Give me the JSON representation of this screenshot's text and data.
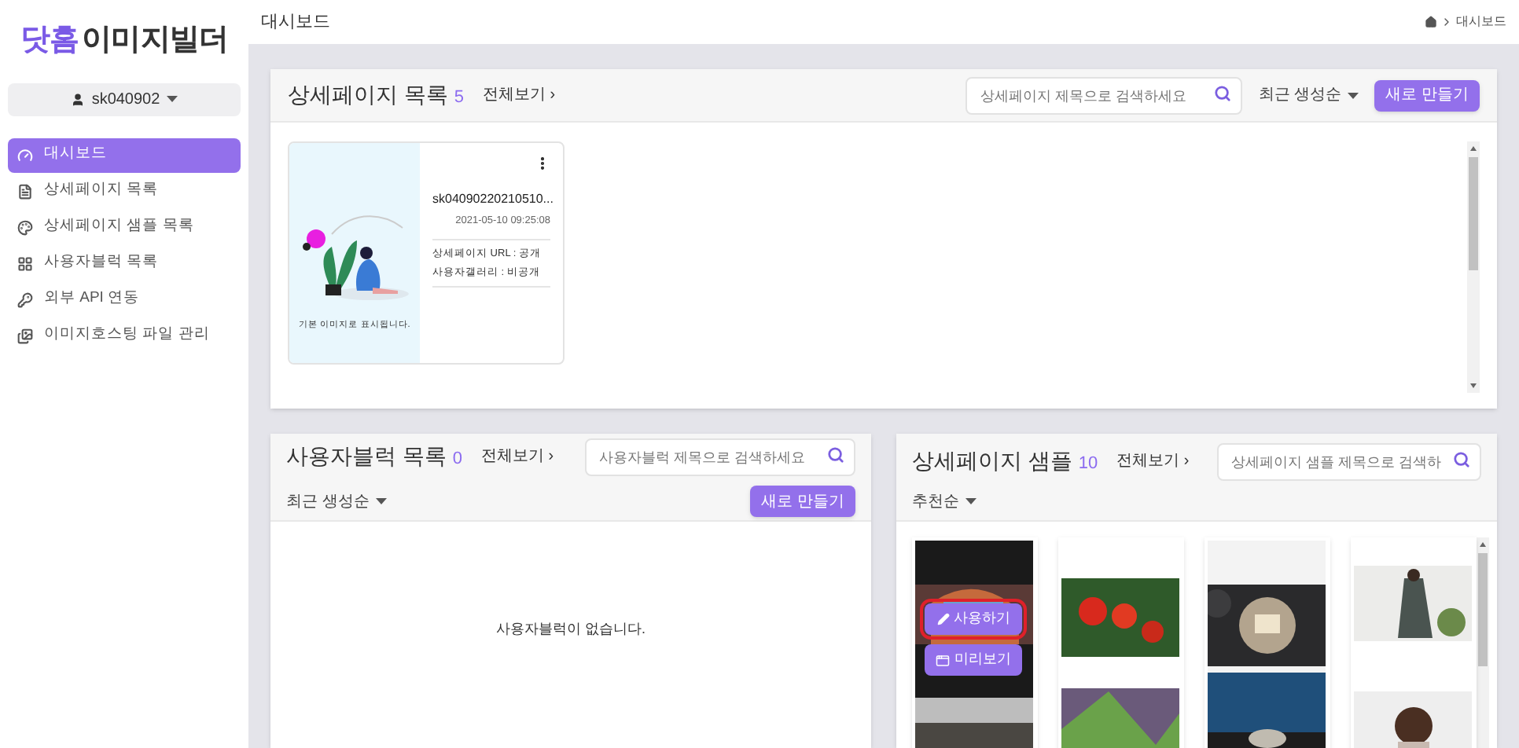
{
  "logo": {
    "part_1": "닷홈",
    "part_2": "이미지빌더"
  },
  "user_menu": {
    "label": "sk040902"
  },
  "sidebar": {
    "items": [
      {
        "label": "대시보드",
        "selected": true
      },
      {
        "label": "상세페이지 목록",
        "selected": false
      },
      {
        "label": "상세페이지 샘플 목록",
        "selected": false
      },
      {
        "label": "사용자블럭 목록",
        "selected": false
      },
      {
        "label": "외부 API 연동",
        "selected": false
      },
      {
        "label": "이미지호스팅 파일 관리",
        "selected": false
      }
    ]
  },
  "header": {
    "title": "대시보드",
    "breadcrumb": "대시보드"
  },
  "detail_pages": {
    "title": "상세페이지 목록",
    "count": "5",
    "view_all": "전체보기 ›",
    "search": {
      "placeholder": "상세페이지 제목으로 검색하세요"
    },
    "sort": "최근 생성순",
    "new_button": "새로 만들기",
    "cards": [
      {
        "image_caption": "기본 이미지로 표시됩니다.",
        "name": "sk04090220210510...",
        "date": "2021-05-10 09:25:08",
        "url_status": "상세페이지 URL : 공개",
        "gallery_status": "사용자갤러리 : 비공개"
      }
    ]
  },
  "user_blocks": {
    "title": "사용자블럭 목록",
    "count": "0",
    "view_all": "전체보기 ›",
    "search": {
      "placeholder": "사용자블럭 제목으로 검색하세요"
    },
    "sort": "최근 생성순",
    "new_button": "새로 만들기",
    "empty_message": "사용자블럭이 없습니다."
  },
  "samples": {
    "title": "상세페이지 샘플",
    "count": "10",
    "view_all": "전체보기 ›",
    "search": {
      "placeholder": "상세페이지 샘플 제목으로 검색하"
    },
    "sort": "추천순",
    "items": [
      {
        "kind": "dark",
        "actions": [
          {
            "label": "사용하기",
            "highlighted": true
          },
          {
            "label": "미리보기",
            "highlighted": false
          }
        ]
      },
      {
        "kind": "tomato"
      },
      {
        "kind": "plate"
      },
      {
        "kind": "fashion"
      }
    ]
  }
}
